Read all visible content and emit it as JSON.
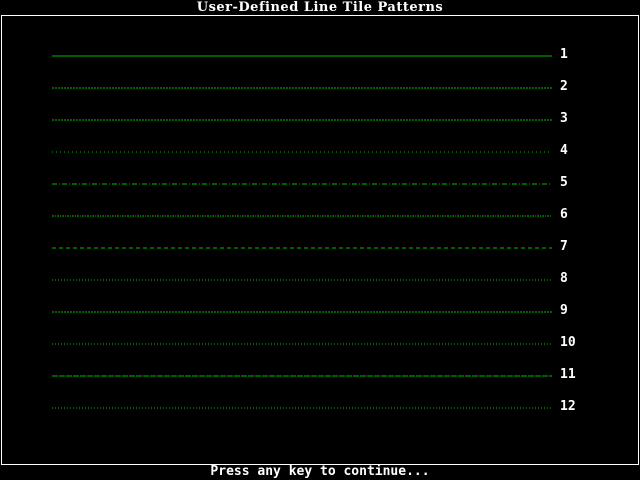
{
  "window": {
    "title": "User-Defined Line Tile Patterns"
  },
  "line_color": "#00c000",
  "patterns": [
    {
      "label": "1",
      "dash": ""
    },
    {
      "label": "2",
      "dash": "2 1"
    },
    {
      "label": "3",
      "dash": "2 1"
    },
    {
      "label": "4",
      "dash": "1 3"
    },
    {
      "label": "5",
      "dash": "5 2 1 2"
    },
    {
      "label": "6",
      "dash": "2 1 1 1"
    },
    {
      "label": "7",
      "dash": "4 3"
    },
    {
      "label": "8",
      "dash": "1 2"
    },
    {
      "label": "9",
      "dash": "2 1"
    },
    {
      "label": "10",
      "dash": "1 2"
    },
    {
      "label": "11",
      "dash": "6 1"
    },
    {
      "label": "12",
      "dash": "1 2"
    }
  ],
  "footer": {
    "prompt": "Press any key to continue..."
  }
}
